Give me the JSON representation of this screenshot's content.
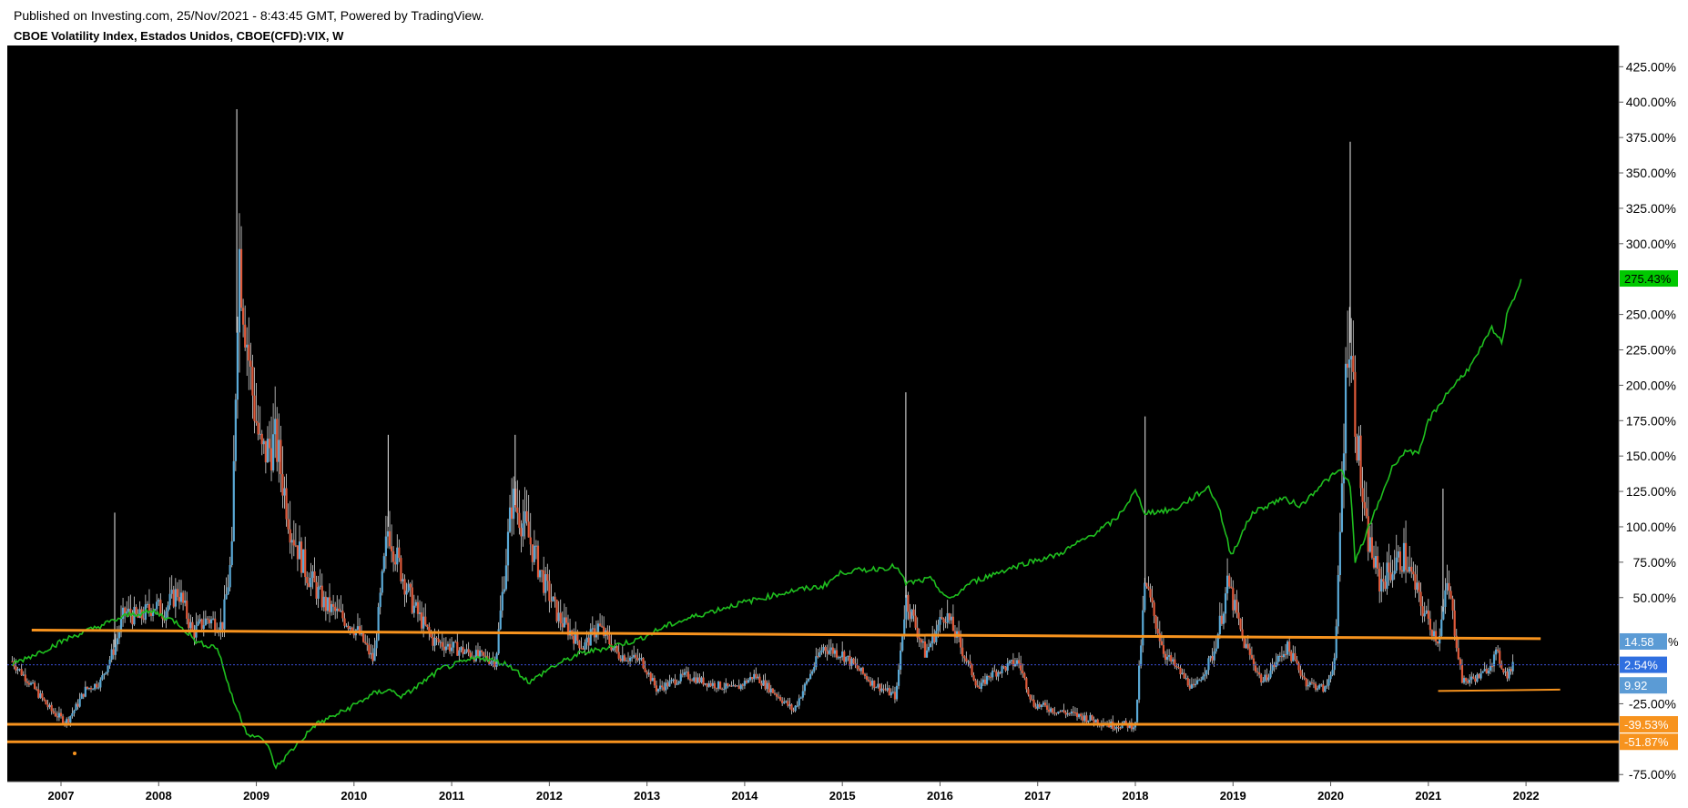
{
  "header": {
    "published": "Published on Investing.com, 25/Nov/2021 - 8:43:45 GMT, Powered by TradingView.",
    "title": "CBOE Volatility Index, Estados Unidos, CBOE(CFD):VIX, W"
  },
  "colors": {
    "background": "#000000",
    "green_line": "#1fbf1f",
    "candle_up": "#5aa9d6",
    "candle_down": "#e05a3a",
    "wick": "#d8d8d8",
    "trendline": "#f7931e",
    "dotted_line": "#3b4fd8",
    "label_green": "#00c800",
    "label_blue": "#5b9bd5",
    "label_blue_dark": "#2f6fe0",
    "label_orange": "#f7931e"
  },
  "chart_data": {
    "type": "candlestick",
    "interval": "W",
    "y_unit": "%",
    "ylim": [
      -80,
      440
    ],
    "y_ticks": [
      "425.00%",
      "400.00%",
      "375.00%",
      "350.00%",
      "325.00%",
      "300.00%",
      "250.00%",
      "225.00%",
      "200.00%",
      "175.00%",
      "150.00%",
      "125.00%",
      "100.00%",
      "75.00%",
      "50.00%",
      "-25.00%",
      "-75.00%"
    ],
    "y_tick_values": [
      425,
      400,
      375,
      350,
      325,
      300,
      250,
      225,
      200,
      175,
      150,
      125,
      100,
      75,
      50,
      -25,
      -75
    ],
    "x_ticks": [
      "2007",
      "2008",
      "2009",
      "2010",
      "2011",
      "2012",
      "2013",
      "2014",
      "2015",
      "2016",
      "2017",
      "2018",
      "2019",
      "2020",
      "2021",
      "2022"
    ],
    "x_tick_values": [
      2007.0,
      2008.0,
      2009.0,
      2010.0,
      2011.0,
      2012.0,
      2013.0,
      2014.0,
      2015.0,
      2016.0,
      2017.0,
      2018.0,
      2019.0,
      2020.0,
      2021.0,
      2022.0
    ],
    "xlim": [
      2006.45,
      2022.95
    ],
    "vix_close_pct": [
      [
        2006.5,
        5
      ],
      [
        2006.7,
        -12
      ],
      [
        2006.9,
        -30
      ],
      [
        2007.05,
        -38
      ],
      [
        2007.15,
        -28
      ],
      [
        2007.25,
        -15
      ],
      [
        2007.4,
        -10
      ],
      [
        2007.55,
        15
      ],
      [
        2007.65,
        40
      ],
      [
        2007.8,
        35
      ],
      [
        2007.95,
        45
      ],
      [
        2008.05,
        40
      ],
      [
        2008.2,
        55
      ],
      [
        2008.35,
        25
      ],
      [
        2008.5,
        35
      ],
      [
        2008.65,
        30
      ],
      [
        2008.75,
        80
      ],
      [
        2008.82,
        300
      ],
      [
        2008.88,
        250
      ],
      [
        2008.95,
        200
      ],
      [
        2009.05,
        150
      ],
      [
        2009.2,
        160
      ],
      [
        2009.35,
        100
      ],
      [
        2009.5,
        70
      ],
      [
        2009.7,
        45
      ],
      [
        2009.9,
        35
      ],
      [
        2010.05,
        25
      ],
      [
        2010.2,
        5
      ],
      [
        2010.35,
        100
      ],
      [
        2010.45,
        75
      ],
      [
        2010.6,
        45
      ],
      [
        2010.8,
        20
      ],
      [
        2011.0,
        15
      ],
      [
        2011.2,
        10
      ],
      [
        2011.45,
        5
      ],
      [
        2011.62,
        120
      ],
      [
        2011.75,
        100
      ],
      [
        2011.95,
        60
      ],
      [
        2012.1,
        35
      ],
      [
        2012.35,
        15
      ],
      [
        2012.5,
        30
      ],
      [
        2012.7,
        10
      ],
      [
        2012.95,
        5
      ],
      [
        2013.1,
        -15
      ],
      [
        2013.4,
        -5
      ],
      [
        2013.6,
        -10
      ],
      [
        2013.9,
        -15
      ],
      [
        2014.1,
        -5
      ],
      [
        2014.35,
        -20
      ],
      [
        2014.5,
        -30
      ],
      [
        2014.8,
        15
      ],
      [
        2015.0,
        10
      ],
      [
        2015.3,
        -10
      ],
      [
        2015.55,
        -20
      ],
      [
        2015.65,
        50
      ],
      [
        2015.85,
        10
      ],
      [
        2016.05,
        40
      ],
      [
        2016.15,
        25
      ],
      [
        2016.4,
        -15
      ],
      [
        2016.5,
        -5
      ],
      [
        2016.8,
        5
      ],
      [
        2016.95,
        -25
      ],
      [
        2017.2,
        -30
      ],
      [
        2017.5,
        -35
      ],
      [
        2017.75,
        -40
      ],
      [
        2018.0,
        -40
      ],
      [
        2018.1,
        60
      ],
      [
        2018.3,
        10
      ],
      [
        2018.6,
        -15
      ],
      [
        2018.8,
        10
      ],
      [
        2018.95,
        60
      ],
      [
        2019.1,
        20
      ],
      [
        2019.3,
        -10
      ],
      [
        2019.55,
        15
      ],
      [
        2019.75,
        -10
      ],
      [
        2019.95,
        -15
      ],
      [
        2020.05,
        10
      ],
      [
        2020.18,
        250
      ],
      [
        2020.25,
        180
      ],
      [
        2020.35,
        100
      ],
      [
        2020.5,
        60
      ],
      [
        2020.75,
        80
      ],
      [
        2020.95,
        40
      ],
      [
        2021.1,
        20
      ],
      [
        2021.2,
        60
      ],
      [
        2021.35,
        -10
      ],
      [
        2021.55,
        -5
      ],
      [
        2021.7,
        10
      ],
      [
        2021.8,
        -5
      ],
      [
        2021.88,
        2.54
      ]
    ],
    "vix_high_spikes_pct": [
      [
        2007.55,
        110
      ],
      [
        2008.8,
        395
      ],
      [
        2010.35,
        165
      ],
      [
        2011.65,
        165
      ],
      [
        2015.65,
        195
      ],
      [
        2018.1,
        178
      ],
      [
        2020.2,
        372
      ],
      [
        2021.15,
        127
      ]
    ],
    "benchmark_green_pct": [
      [
        2006.5,
        3
      ],
      [
        2006.8,
        12
      ],
      [
        2007.1,
        22
      ],
      [
        2007.4,
        30
      ],
      [
        2007.7,
        38
      ],
      [
        2007.95,
        40
      ],
      [
        2008.2,
        32
      ],
      [
        2008.4,
        18
      ],
      [
        2008.6,
        15
      ],
      [
        2008.75,
        -20
      ],
      [
        2008.9,
        -45
      ],
      [
        2009.1,
        -52
      ],
      [
        2009.2,
        -70
      ],
      [
        2009.4,
        -55
      ],
      [
        2009.6,
        -40
      ],
      [
        2009.9,
        -30
      ],
      [
        2010.2,
        -18
      ],
      [
        2010.35,
        -15
      ],
      [
        2010.5,
        -20
      ],
      [
        2010.7,
        -10
      ],
      [
        2010.9,
        0
      ],
      [
        2011.3,
        8
      ],
      [
        2011.6,
        2
      ],
      [
        2011.8,
        -10
      ],
      [
        2012.0,
        0
      ],
      [
        2012.3,
        10
      ],
      [
        2012.6,
        15
      ],
      [
        2012.9,
        20
      ],
      [
        2013.2,
        30
      ],
      [
        2013.5,
        37
      ],
      [
        2013.9,
        45
      ],
      [
        2014.2,
        50
      ],
      [
        2014.5,
        55
      ],
      [
        2014.8,
        58
      ],
      [
        2015.0,
        68
      ],
      [
        2015.3,
        70
      ],
      [
        2015.55,
        72
      ],
      [
        2015.65,
        60
      ],
      [
        2015.9,
        63
      ],
      [
        2016.1,
        48
      ],
      [
        2016.3,
        60
      ],
      [
        2016.6,
        68
      ],
      [
        2016.9,
        75
      ],
      [
        2017.2,
        80
      ],
      [
        2017.5,
        92
      ],
      [
        2017.8,
        105
      ],
      [
        2018.0,
        125
      ],
      [
        2018.1,
        110
      ],
      [
        2018.4,
        112
      ],
      [
        2018.75,
        128
      ],
      [
        2018.85,
        115
      ],
      [
        2018.98,
        80
      ],
      [
        2019.2,
        110
      ],
      [
        2019.5,
        120
      ],
      [
        2019.7,
        115
      ],
      [
        2019.9,
        130
      ],
      [
        2020.1,
        140
      ],
      [
        2020.2,
        130
      ],
      [
        2020.25,
        75
      ],
      [
        2020.45,
        110
      ],
      [
        2020.65,
        145
      ],
      [
        2020.8,
        155
      ],
      [
        2020.9,
        150
      ],
      [
        2021.0,
        175
      ],
      [
        2021.2,
        195
      ],
      [
        2021.45,
        215
      ],
      [
        2021.65,
        240
      ],
      [
        2021.75,
        230
      ],
      [
        2021.82,
        255
      ],
      [
        2021.9,
        265
      ],
      [
        2021.95,
        275
      ]
    ],
    "price_labels": [
      {
        "text": "275.43%",
        "value": 275.43,
        "color": "#00c800",
        "text_color": "#000000"
      },
      {
        "text": "14.58",
        "value": 19,
        "color": "#5b9bd5",
        "text_color": "#ffffff",
        "suffix": "%"
      },
      {
        "text": "2.54%",
        "value": 2.54,
        "color": "#2f6fe0",
        "text_color": "#ffffff"
      },
      {
        "text": "9.92",
        "value": -12,
        "color": "#5b9bd5",
        "text_color": "#ffffff"
      },
      {
        "text": "-39.53%",
        "value": -39.53,
        "color": "#f7931e",
        "text_color": "#ffffff"
      },
      {
        "text": "-51.87%",
        "value": -51.87,
        "color": "#f7931e",
        "text_color": "#ffffff"
      }
    ],
    "trendlines": [
      {
        "name": "upper-resistance",
        "x1": 2006.7,
        "y1": 27,
        "x2": 2022.15,
        "y2": 21
      },
      {
        "name": "lower-support-1",
        "x1": 2006.45,
        "y1": -39.53,
        "x2": 2022.95,
        "y2": -39.53
      },
      {
        "name": "lower-support-2",
        "x1": 2006.45,
        "y1": -51.87,
        "x2": 2022.95,
        "y2": -51.87
      },
      {
        "name": "short-support-2021",
        "x1": 2021.1,
        "y1": -16,
        "x2": 2022.35,
        "y2": -15
      }
    ],
    "dotted_line_value": 2.54
  }
}
